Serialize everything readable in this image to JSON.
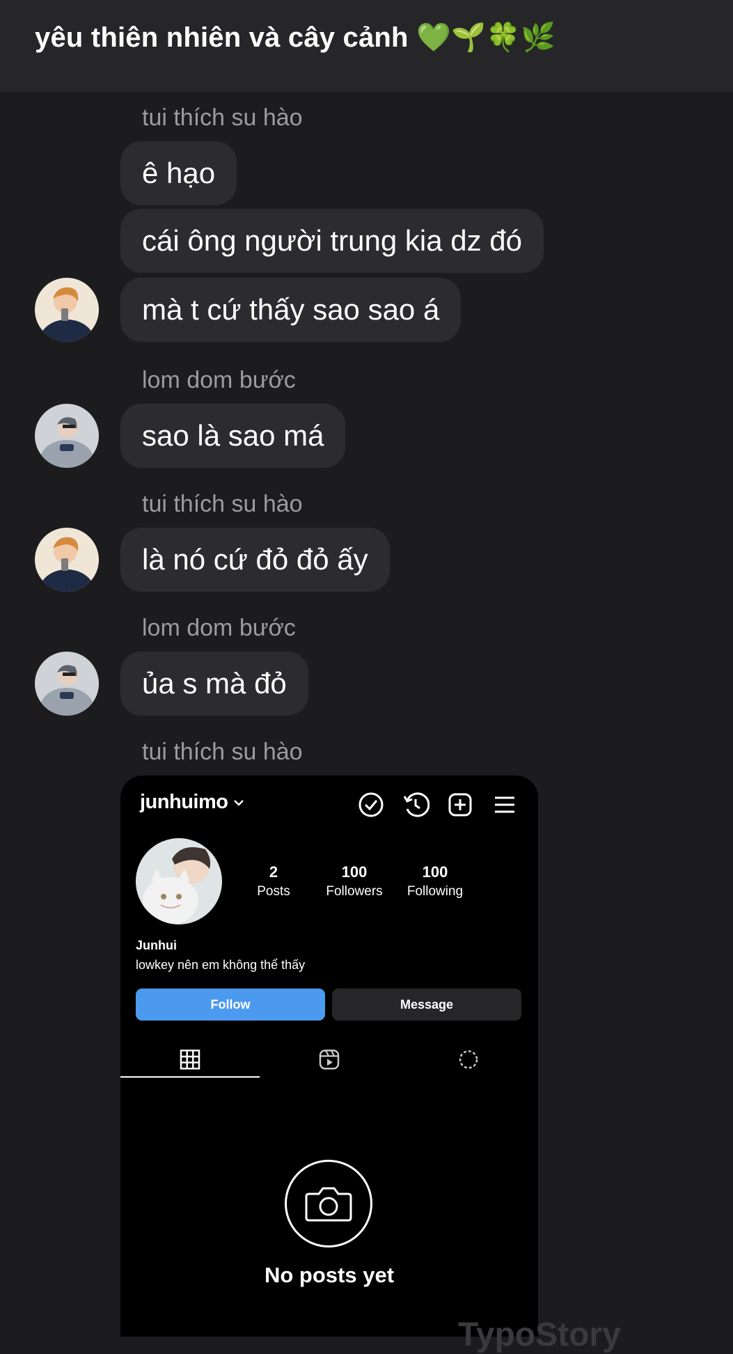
{
  "header": {
    "title": "yêu thiên nhiên và cây cảnh 💚🌱🍀🌿"
  },
  "messages": [
    {
      "sender": "tui thích su hào",
      "lines": [
        "ê hạo",
        "cái ông người trung kia dz đó",
        "mà t cứ thấy sao sao á"
      ]
    },
    {
      "sender": "lom dom bước",
      "lines": [
        "sao là sao má"
      ]
    },
    {
      "sender": "tui thích su hào",
      "lines": [
        "là nó cứ đỏ đỏ ấy"
      ]
    },
    {
      "sender": "lom dom bước",
      "lines": [
        "ủa s mà đỏ"
      ]
    },
    {
      "sender": "tui thích su hào",
      "lines": []
    }
  ],
  "shared_screenshot": {
    "username": "junhuimo",
    "icons": [
      "check-circle-icon",
      "history-icon",
      "add-square-icon",
      "menu-icon"
    ],
    "stats": [
      {
        "value": "2",
        "label": "Posts"
      },
      {
        "value": "100",
        "label": "Followers"
      },
      {
        "value": "100",
        "label": "Following"
      }
    ],
    "name": "Junhui",
    "bio": "lowkey nên em không thể thấy",
    "follow_label": "Follow",
    "message_label": "Message",
    "tabs": [
      "grid-icon",
      "reels-icon",
      "tagged-icon"
    ],
    "empty_text": "No posts yet",
    "colors": {
      "follow": "#4c9af0",
      "background": "#000000"
    }
  },
  "watermark": "TypoStory",
  "colors": {
    "page_bg": "#1c1c1e",
    "bubble_bg": "#2c2c2e",
    "sender_text": "#9b9ba0"
  }
}
